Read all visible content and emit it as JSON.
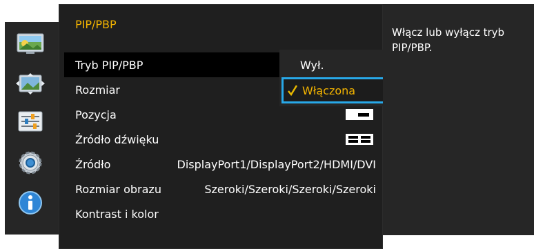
{
  "panel": {
    "title": "PIP/PBP"
  },
  "menu": {
    "items": [
      {
        "label": "Tryb PIP/PBP",
        "value": ""
      },
      {
        "label": "Rozmiar",
        "value": ""
      },
      {
        "label": "Pozycja",
        "value": ""
      },
      {
        "label": "Źródło dźwięku",
        "value": ""
      },
      {
        "label": "Źródło",
        "value": "DisplayPort1/DisplayPort2/HDMI/DVI"
      },
      {
        "label": "Rozmiar obrazu",
        "value": "Szeroki/Szeroki/Szeroki/Szeroki"
      },
      {
        "label": "Kontrast i kolor",
        "value": ""
      }
    ]
  },
  "dropdown": {
    "options": [
      {
        "label": "Wył."
      },
      {
        "label": "Włączona"
      }
    ]
  },
  "help": {
    "text": "Włącz lub wyłącz tryb PIP/PBP."
  },
  "icons": {
    "sidebar": [
      "picture-icon",
      "onscreen-display-icon",
      "setup-icon",
      "system-gear-icon",
      "information-icon"
    ]
  },
  "colors": {
    "title": "#f2b300",
    "focus_border": "#28a8e8",
    "panel_bg": "#1f1f1f",
    "selected_row_bg": "#000000"
  }
}
